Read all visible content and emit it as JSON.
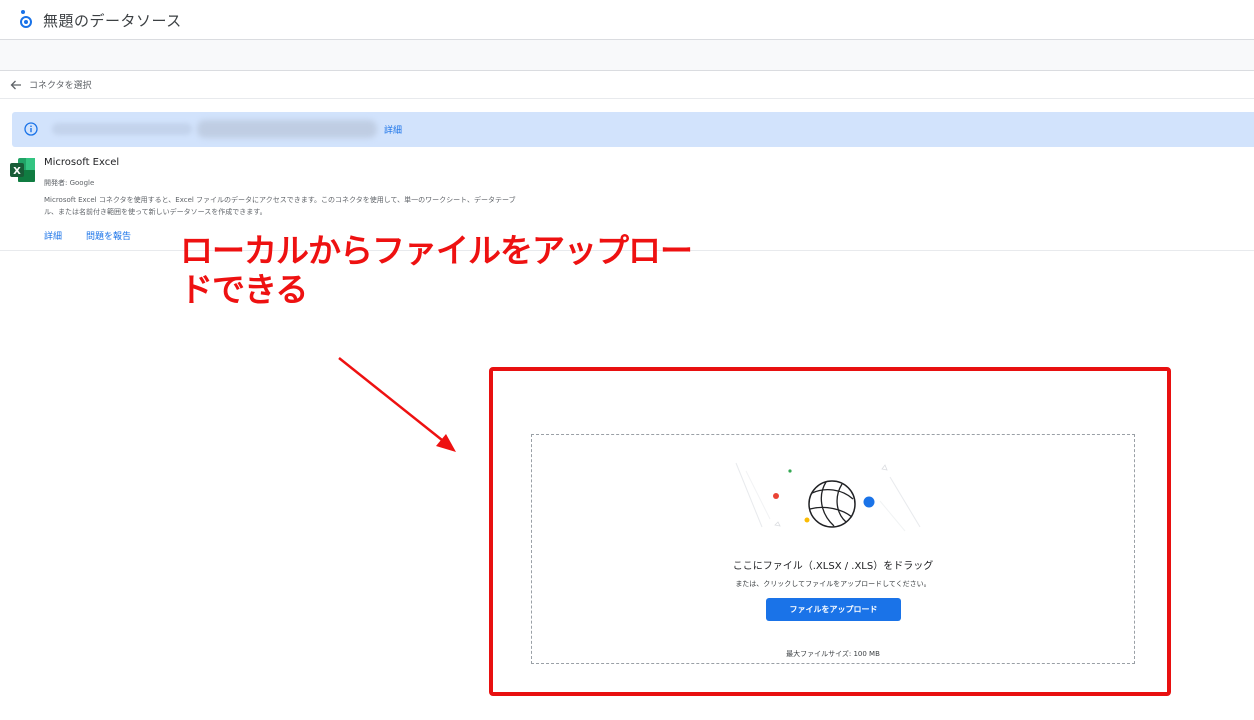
{
  "header": {
    "title": "無題のデータソース"
  },
  "nav": {
    "back_label": "コネクタを選択"
  },
  "banner": {
    "link_label": "詳細"
  },
  "connector": {
    "name": "Microsoft Excel",
    "developer": "開発者: Google",
    "description": "Microsoft Excel コネクタを使用すると、Excel ファイルのデータにアクセスできます。このコネクタを使用して、単一のワークシート、データテーブル、または名前付き範囲を使って新しいデータソースを作成できます。",
    "links": {
      "details": "詳細",
      "report": "問題を報告"
    }
  },
  "annotation": {
    "text": "ローカルからファイルをアップロードできる"
  },
  "upload": {
    "drop_title": "ここにファイル（.XLSX / .XLS）をドラッグ",
    "drop_subtitle": "または、クリックしてファイルをアップロードしてください。",
    "button_label": "ファイルをアップロード",
    "max_size": "最大ファイルサイズ: 100 MB"
  },
  "colors": {
    "accent": "#1a73e8",
    "banner": "#d2e3fc",
    "annotation_red": "#ee1111",
    "excel_green": "#1e7145"
  }
}
